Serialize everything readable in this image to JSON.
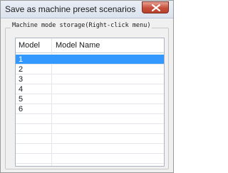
{
  "window": {
    "title": "Save as machine preset scenarios"
  },
  "group": {
    "label": "Machine mode storage(Right-click menu)"
  },
  "table": {
    "columns": [
      "Model",
      "Model Name"
    ],
    "rows": [
      {
        "model": "1",
        "name": "",
        "selected": true
      },
      {
        "model": "2",
        "name": ""
      },
      {
        "model": "3",
        "name": ""
      },
      {
        "model": "4",
        "name": ""
      },
      {
        "model": "5",
        "name": ""
      },
      {
        "model": "6",
        "name": ""
      },
      {
        "model": "",
        "name": ""
      },
      {
        "model": "",
        "name": ""
      },
      {
        "model": "",
        "name": ""
      },
      {
        "model": "",
        "name": ""
      },
      {
        "model": "",
        "name": ""
      }
    ]
  },
  "colors": {
    "selection": "#3399ff",
    "close_button": "#c7503b"
  },
  "icons": {
    "close": "close-icon"
  }
}
